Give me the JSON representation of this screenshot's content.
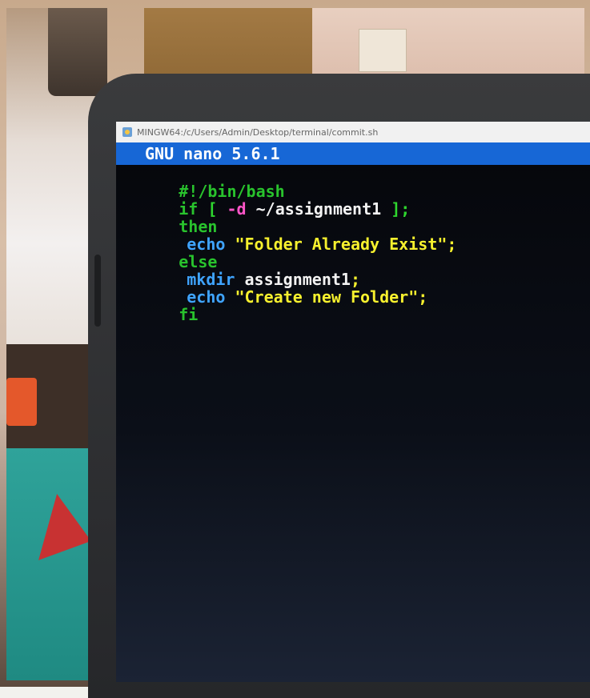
{
  "window": {
    "title": "MINGW64:/c/Users/Admin/Desktop/terminal/commit.sh",
    "icon": "terminal-app-icon"
  },
  "nano": {
    "header": "GNU nano 5.6.1"
  },
  "code": {
    "line1": "#!/bin/bash",
    "line2_kw": "if",
    "line2_open": "[",
    "line2_flag": "-d",
    "line2_path": "~/assignment1",
    "line2_close": "];",
    "line3": "then",
    "line4_cmd": "echo",
    "line4_str": "\"Folder Already Exist\"",
    "line4_semi": ";",
    "line5": "else",
    "line6_cmd": "mkdir",
    "line6_arg": "assignment1",
    "line6_semi": ";",
    "line7_cmd": "echo",
    "line7_str": "\"Create new Folder\"",
    "line7_semi": ";",
    "line8": "fi"
  },
  "colors": {
    "nano_bar": "#1767d6",
    "keyword": "#29c32d",
    "command": "#3fa4ff",
    "string": "#f7f12e",
    "operator": "#ff55c8"
  }
}
